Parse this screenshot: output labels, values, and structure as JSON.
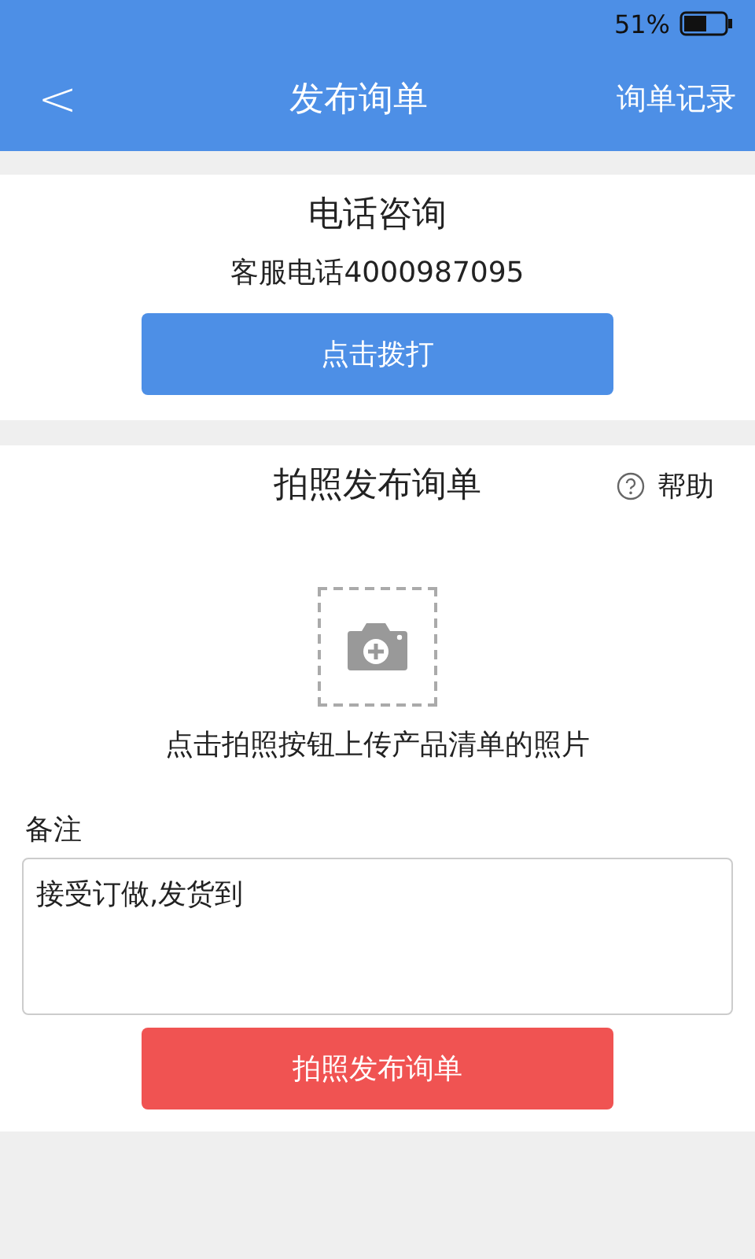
{
  "status_bar": {
    "battery": "51%"
  },
  "nav": {
    "back": "<",
    "title": "发布询单",
    "action": "询单记录"
  },
  "phone_section": {
    "title": "电话咨询",
    "phone": "客服电话4000987095",
    "button": "点击拨打"
  },
  "photo_section": {
    "title": "拍照发布询单",
    "help": "帮助",
    "hint": "点击拍照按钮上传产品清单的照片",
    "note_label": "备注",
    "note_value": "接受订做,发货到",
    "submit": "拍照发布询单"
  }
}
